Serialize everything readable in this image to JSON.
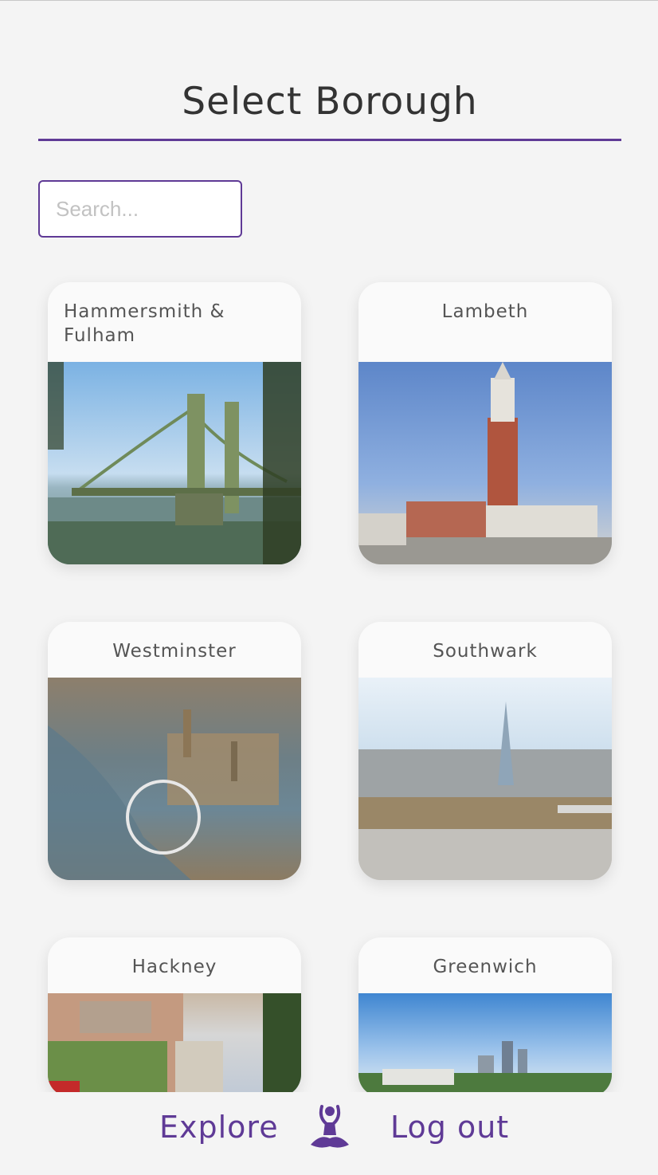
{
  "page": {
    "title": "Select Borough"
  },
  "search": {
    "placeholder": "Search..."
  },
  "boroughs": [
    {
      "name": "Hammersmith & Fulham"
    },
    {
      "name": "Lambeth"
    },
    {
      "name": "Westminster"
    },
    {
      "name": "Southwark"
    },
    {
      "name": "Hackney"
    },
    {
      "name": "Greenwich"
    }
  ],
  "footer": {
    "explore_label": "Explore",
    "logout_label": "Log out",
    "logo_icon": "meditation-person-icon"
  },
  "colors": {
    "accent": "#5f3a96",
    "background": "#f4f4f4"
  }
}
